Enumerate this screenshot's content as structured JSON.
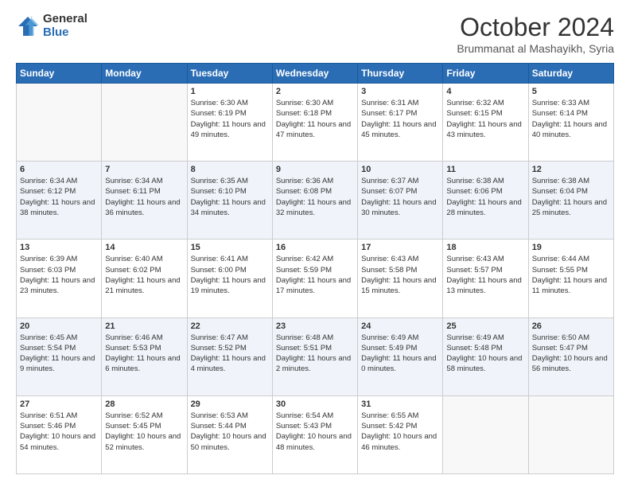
{
  "logo": {
    "general": "General",
    "blue": "Blue"
  },
  "header": {
    "month": "October 2024",
    "location": "Brummanat al Mashayikh, Syria"
  },
  "weekdays": [
    "Sunday",
    "Monday",
    "Tuesday",
    "Wednesday",
    "Thursday",
    "Friday",
    "Saturday"
  ],
  "weeks": [
    [
      {
        "day": "",
        "info": ""
      },
      {
        "day": "",
        "info": ""
      },
      {
        "day": "1",
        "info": "Sunrise: 6:30 AM\nSunset: 6:19 PM\nDaylight: 11 hours and 49 minutes."
      },
      {
        "day": "2",
        "info": "Sunrise: 6:30 AM\nSunset: 6:18 PM\nDaylight: 11 hours and 47 minutes."
      },
      {
        "day": "3",
        "info": "Sunrise: 6:31 AM\nSunset: 6:17 PM\nDaylight: 11 hours and 45 minutes."
      },
      {
        "day": "4",
        "info": "Sunrise: 6:32 AM\nSunset: 6:15 PM\nDaylight: 11 hours and 43 minutes."
      },
      {
        "day": "5",
        "info": "Sunrise: 6:33 AM\nSunset: 6:14 PM\nDaylight: 11 hours and 40 minutes."
      }
    ],
    [
      {
        "day": "6",
        "info": "Sunrise: 6:34 AM\nSunset: 6:12 PM\nDaylight: 11 hours and 38 minutes."
      },
      {
        "day": "7",
        "info": "Sunrise: 6:34 AM\nSunset: 6:11 PM\nDaylight: 11 hours and 36 minutes."
      },
      {
        "day": "8",
        "info": "Sunrise: 6:35 AM\nSunset: 6:10 PM\nDaylight: 11 hours and 34 minutes."
      },
      {
        "day": "9",
        "info": "Sunrise: 6:36 AM\nSunset: 6:08 PM\nDaylight: 11 hours and 32 minutes."
      },
      {
        "day": "10",
        "info": "Sunrise: 6:37 AM\nSunset: 6:07 PM\nDaylight: 11 hours and 30 minutes."
      },
      {
        "day": "11",
        "info": "Sunrise: 6:38 AM\nSunset: 6:06 PM\nDaylight: 11 hours and 28 minutes."
      },
      {
        "day": "12",
        "info": "Sunrise: 6:38 AM\nSunset: 6:04 PM\nDaylight: 11 hours and 25 minutes."
      }
    ],
    [
      {
        "day": "13",
        "info": "Sunrise: 6:39 AM\nSunset: 6:03 PM\nDaylight: 11 hours and 23 minutes."
      },
      {
        "day": "14",
        "info": "Sunrise: 6:40 AM\nSunset: 6:02 PM\nDaylight: 11 hours and 21 minutes."
      },
      {
        "day": "15",
        "info": "Sunrise: 6:41 AM\nSunset: 6:00 PM\nDaylight: 11 hours and 19 minutes."
      },
      {
        "day": "16",
        "info": "Sunrise: 6:42 AM\nSunset: 5:59 PM\nDaylight: 11 hours and 17 minutes."
      },
      {
        "day": "17",
        "info": "Sunrise: 6:43 AM\nSunset: 5:58 PM\nDaylight: 11 hours and 15 minutes."
      },
      {
        "day": "18",
        "info": "Sunrise: 6:43 AM\nSunset: 5:57 PM\nDaylight: 11 hours and 13 minutes."
      },
      {
        "day": "19",
        "info": "Sunrise: 6:44 AM\nSunset: 5:55 PM\nDaylight: 11 hours and 11 minutes."
      }
    ],
    [
      {
        "day": "20",
        "info": "Sunrise: 6:45 AM\nSunset: 5:54 PM\nDaylight: 11 hours and 9 minutes."
      },
      {
        "day": "21",
        "info": "Sunrise: 6:46 AM\nSunset: 5:53 PM\nDaylight: 11 hours and 6 minutes."
      },
      {
        "day": "22",
        "info": "Sunrise: 6:47 AM\nSunset: 5:52 PM\nDaylight: 11 hours and 4 minutes."
      },
      {
        "day": "23",
        "info": "Sunrise: 6:48 AM\nSunset: 5:51 PM\nDaylight: 11 hours and 2 minutes."
      },
      {
        "day": "24",
        "info": "Sunrise: 6:49 AM\nSunset: 5:49 PM\nDaylight: 11 hours and 0 minutes."
      },
      {
        "day": "25",
        "info": "Sunrise: 6:49 AM\nSunset: 5:48 PM\nDaylight: 10 hours and 58 minutes."
      },
      {
        "day": "26",
        "info": "Sunrise: 6:50 AM\nSunset: 5:47 PM\nDaylight: 10 hours and 56 minutes."
      }
    ],
    [
      {
        "day": "27",
        "info": "Sunrise: 6:51 AM\nSunset: 5:46 PM\nDaylight: 10 hours and 54 minutes."
      },
      {
        "day": "28",
        "info": "Sunrise: 6:52 AM\nSunset: 5:45 PM\nDaylight: 10 hours and 52 minutes."
      },
      {
        "day": "29",
        "info": "Sunrise: 6:53 AM\nSunset: 5:44 PM\nDaylight: 10 hours and 50 minutes."
      },
      {
        "day": "30",
        "info": "Sunrise: 6:54 AM\nSunset: 5:43 PM\nDaylight: 10 hours and 48 minutes."
      },
      {
        "day": "31",
        "info": "Sunrise: 6:55 AM\nSunset: 5:42 PM\nDaylight: 10 hours and 46 minutes."
      },
      {
        "day": "",
        "info": ""
      },
      {
        "day": "",
        "info": ""
      }
    ]
  ]
}
